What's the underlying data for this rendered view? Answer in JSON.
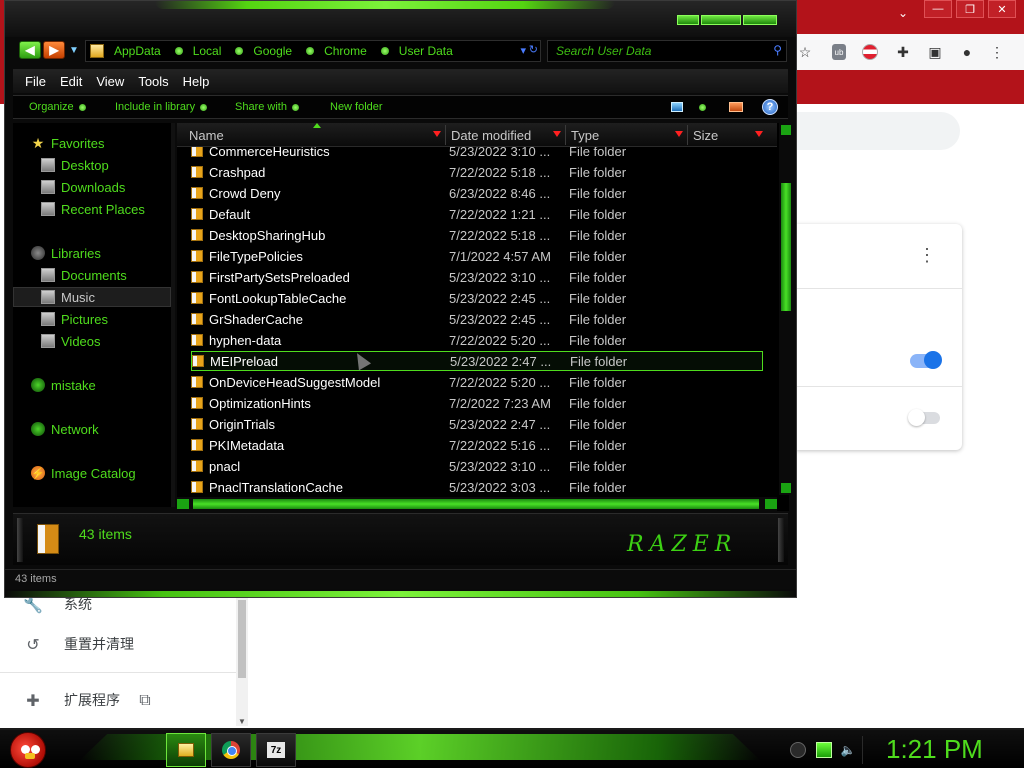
{
  "explorer": {
    "breadcrumbs": [
      "AppData",
      "Local",
      "Google",
      "Chrome",
      "User Data"
    ],
    "search_placeholder": "Search User Data",
    "menu": [
      "File",
      "Edit",
      "View",
      "Tools",
      "Help"
    ],
    "commands": [
      "Organize",
      "Include in library",
      "Share with",
      "New folder"
    ],
    "nav": {
      "favorites_label": "Favorites",
      "favorites": [
        "Desktop",
        "Downloads",
        "Recent Places"
      ],
      "libraries_label": "Libraries",
      "libraries": [
        "Documents",
        "Music",
        "Pictures",
        "Videos"
      ],
      "selected": "Music",
      "others": [
        "mistake",
        "Network",
        "Image Catalog"
      ]
    },
    "columns": [
      "Name",
      "Date modified",
      "Type",
      "Size"
    ],
    "rows": [
      {
        "name": "CommerceHeuristics",
        "date": "5/23/2022 3:10 ...",
        "type": "File folder"
      },
      {
        "name": "Crashpad",
        "date": "7/22/2022 5:18 ...",
        "type": "File folder"
      },
      {
        "name": "Crowd Deny",
        "date": "6/23/2022 8:46 ...",
        "type": "File folder"
      },
      {
        "name": "Default",
        "date": "7/22/2022 1:21 ...",
        "type": "File folder"
      },
      {
        "name": "DesktopSharingHub",
        "date": "7/22/2022 5:18 ...",
        "type": "File folder"
      },
      {
        "name": "FileTypePolicies",
        "date": "7/1/2022 4:57 AM",
        "type": "File folder"
      },
      {
        "name": "FirstPartySetsPreloaded",
        "date": "5/23/2022 3:10 ...",
        "type": "File folder"
      },
      {
        "name": "FontLookupTableCache",
        "date": "5/23/2022 2:45 ...",
        "type": "File folder"
      },
      {
        "name": "GrShaderCache",
        "date": "5/23/2022 2:45 ...",
        "type": "File folder"
      },
      {
        "name": "hyphen-data",
        "date": "7/22/2022 5:20 ...",
        "type": "File folder"
      },
      {
        "name": "MEIPreload",
        "date": "5/23/2022 2:47 ...",
        "type": "File folder",
        "selected": true
      },
      {
        "name": "OnDeviceHeadSuggestModel",
        "date": "7/22/2022 5:20 ...",
        "type": "File folder"
      },
      {
        "name": "OptimizationHints",
        "date": "7/2/2022 7:23 AM",
        "type": "File folder"
      },
      {
        "name": "OriginTrials",
        "date": "5/23/2022 2:47 ...",
        "type": "File folder"
      },
      {
        "name": "PKIMetadata",
        "date": "7/22/2022 5:16 ...",
        "type": "File folder"
      },
      {
        "name": "pnacl",
        "date": "5/23/2022 3:10 ...",
        "type": "File folder"
      },
      {
        "name": "PnaclTranslationCache",
        "date": "5/23/2022 3:03 ...",
        "type": "File folder"
      }
    ],
    "details_count": "43 items",
    "status_text": "43 items",
    "razer_text": "RAZER"
  },
  "chrome_side": {
    "items": [
      "系统",
      "重置并清理",
      "扩展程序"
    ]
  },
  "taskbar": {
    "clock": "1:21 PM",
    "seven_zip_label": "7z"
  },
  "colors": {
    "accent_green": "#4fdc1d",
    "chrome_red": "#b3131a",
    "toggle_blue": "#1a73e8"
  }
}
